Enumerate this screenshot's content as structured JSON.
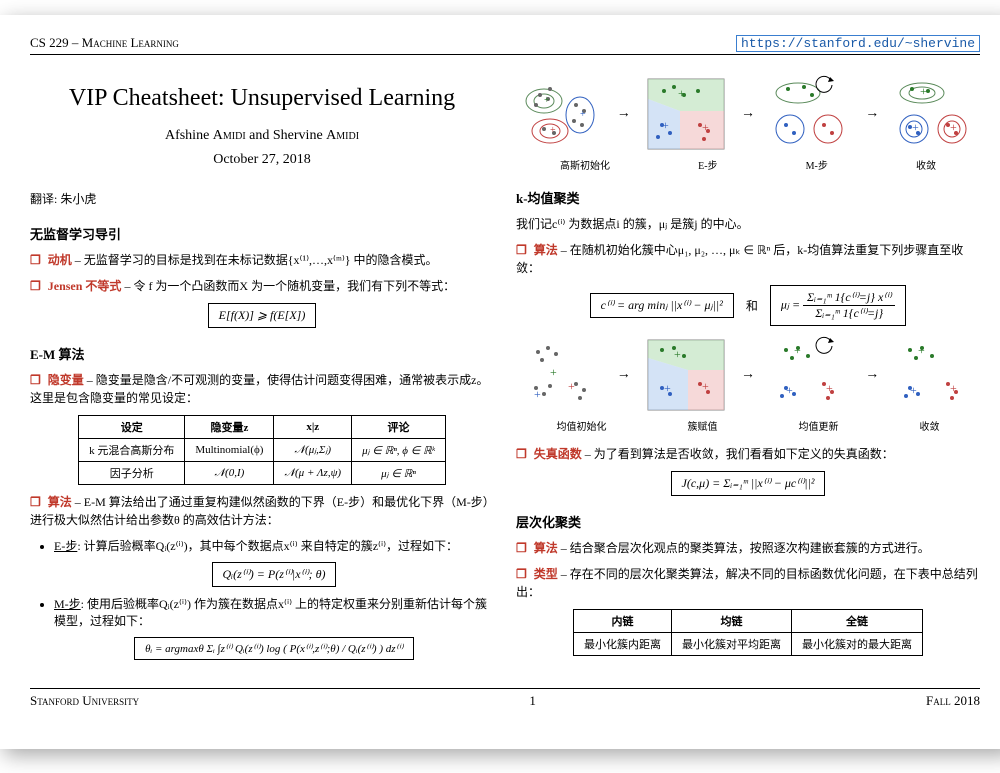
{
  "header": {
    "left": "CS 229 – Machine Learning",
    "url": "https://stanford.edu/~shervine"
  },
  "title": "VIP Cheatsheet: Unsupervised Learning",
  "authors": "Afshine Amidi and Shervine Amidi",
  "date": "October 27, 2018",
  "translator_label": "翻译: 朱小虎",
  "sec1": {
    "heading": "无监督学习导引",
    "motive_kw": "动机",
    "motive_text": " – 无监督学习的目标是找到在未标记数据{x⁽¹⁾,…,x⁽ᵐ⁾} 中的隐含模式。",
    "jensen_kw": "Jensen 不等式",
    "jensen_text": " – 令 f 为一个凸函数而X 为一个随机变量，我们有下列不等式：",
    "jensen_formula": "E[f(X)] ⩾ f(E[X])"
  },
  "sec2": {
    "heading": "E-M 算法",
    "latent_kw": "隐变量",
    "latent_text": " – 隐变量是隐含/不可观测的变量，使得估计问题变得困难，通常被表示成z。这里是包含隐变量的常见设定：",
    "table": {
      "h1": "设定",
      "h2": "隐变量z",
      "h3": "x|z",
      "h4": "评论",
      "r1c1": "k 元混合高斯分布",
      "r1c2": "Multinomial(ϕ)",
      "r1c3": "𝒩(μⱼ,Σⱼ)",
      "r1c4": "μⱼ ∈ ℝⁿ, ϕ ∈ ℝᵏ",
      "r2c1": "因子分析",
      "r2c2": "𝒩(0,I)",
      "r2c3": "𝒩(μ + Λz,ψ)",
      "r2c4": "μⱼ ∈ ℝⁿ"
    },
    "algo_kw": "算法",
    "algo_text": " – E-M 算法给出了通过重复构建似然函数的下界（E-步）和最优化下界（M-步）进行极大似然估计给出参数θ 的高效估计方法：",
    "estep_label": "E-步",
    "estep_text": ": 计算后验概率Qᵢ(z⁽ⁱ⁾)，其中每个数据点x⁽ⁱ⁾ 来自特定的簇z⁽ⁱ⁾，过程如下：",
    "estep_formula": "Qᵢ(z⁽ⁱ⁾) = P(z⁽ⁱ⁾|x⁽ⁱ⁾; θ)",
    "mstep_label": "M-步",
    "mstep_text": ": 使用后验概率Qᵢ(z⁽ⁱ⁾) 作为簇在数据点x⁽ⁱ⁾ 上的特定权重来分别重新估计每个簇模型，过程如下：",
    "mstep_formula": "θᵢ = argmaxθ  Σᵢ ∫z⁽ⁱ⁾ Qᵢ(z⁽ⁱ⁾) log ( P(x⁽ⁱ⁾,z⁽ⁱ⁾;θ) / Qᵢ(z⁽ⁱ⁾) ) dz⁽ⁱ⁾"
  },
  "figs": {
    "gauss_init": "高斯初始化",
    "e_step": "E-步",
    "m_step": "M-步",
    "converge": "收敛",
    "mean_init": "均值初始化",
    "assign": "簇赋值",
    "mean_update": "均值更新"
  },
  "sec3": {
    "heading": "k-均值聚类",
    "intro": "我们记c⁽ⁱ⁾ 为数据点i 的簇，μⱼ 是簇j 的中心。",
    "algo_kw": "算法",
    "algo_text": " – 在随机初始化簇中心μ₁, μ₂, …, μₖ ∈ ℝⁿ 后，k-均值算法重复下列步骤直至收敛：",
    "formula_c": "c⁽ⁱ⁾ = arg minⱼ ||x⁽ⁱ⁾ − μⱼ||²",
    "and": "和",
    "mu_num": "Σᵢ₌₁ᵐ 1{c⁽ⁱ⁾=j} x⁽ⁱ⁾",
    "mu_den": "Σᵢ₌₁ᵐ 1{c⁽ⁱ⁾=j}",
    "mu_lhs": "μⱼ =",
    "loss_kw": "失真函数",
    "loss_text": " – 为了看到算法是否收敛，我们看看如下定义的失真函数：",
    "loss_formula": "J(c,μ) = Σᵢ₌₁ᵐ ||x⁽ⁱ⁾ − μc⁽ⁱ⁾||²"
  },
  "sec4": {
    "heading": "层次化聚类",
    "algo_kw": "算法",
    "algo_text": " – 结合聚合层次化观点的聚类算法，按照逐次构建嵌套簇的方式进行。",
    "type_kw": "类型",
    "type_text": " – 存在不同的层次化聚类算法，解决不同的目标函数优化问题，在下表中总结列出：",
    "table": {
      "h1": "内链",
      "h2": "均链",
      "h3": "全链",
      "r1": "最小化簇内距离",
      "r2": "最小化簇对平均距离",
      "r3": "最小化簇对的最大距离"
    }
  },
  "footer": {
    "left": "Stanford University",
    "page": "1",
    "right": "Fall 2018"
  }
}
